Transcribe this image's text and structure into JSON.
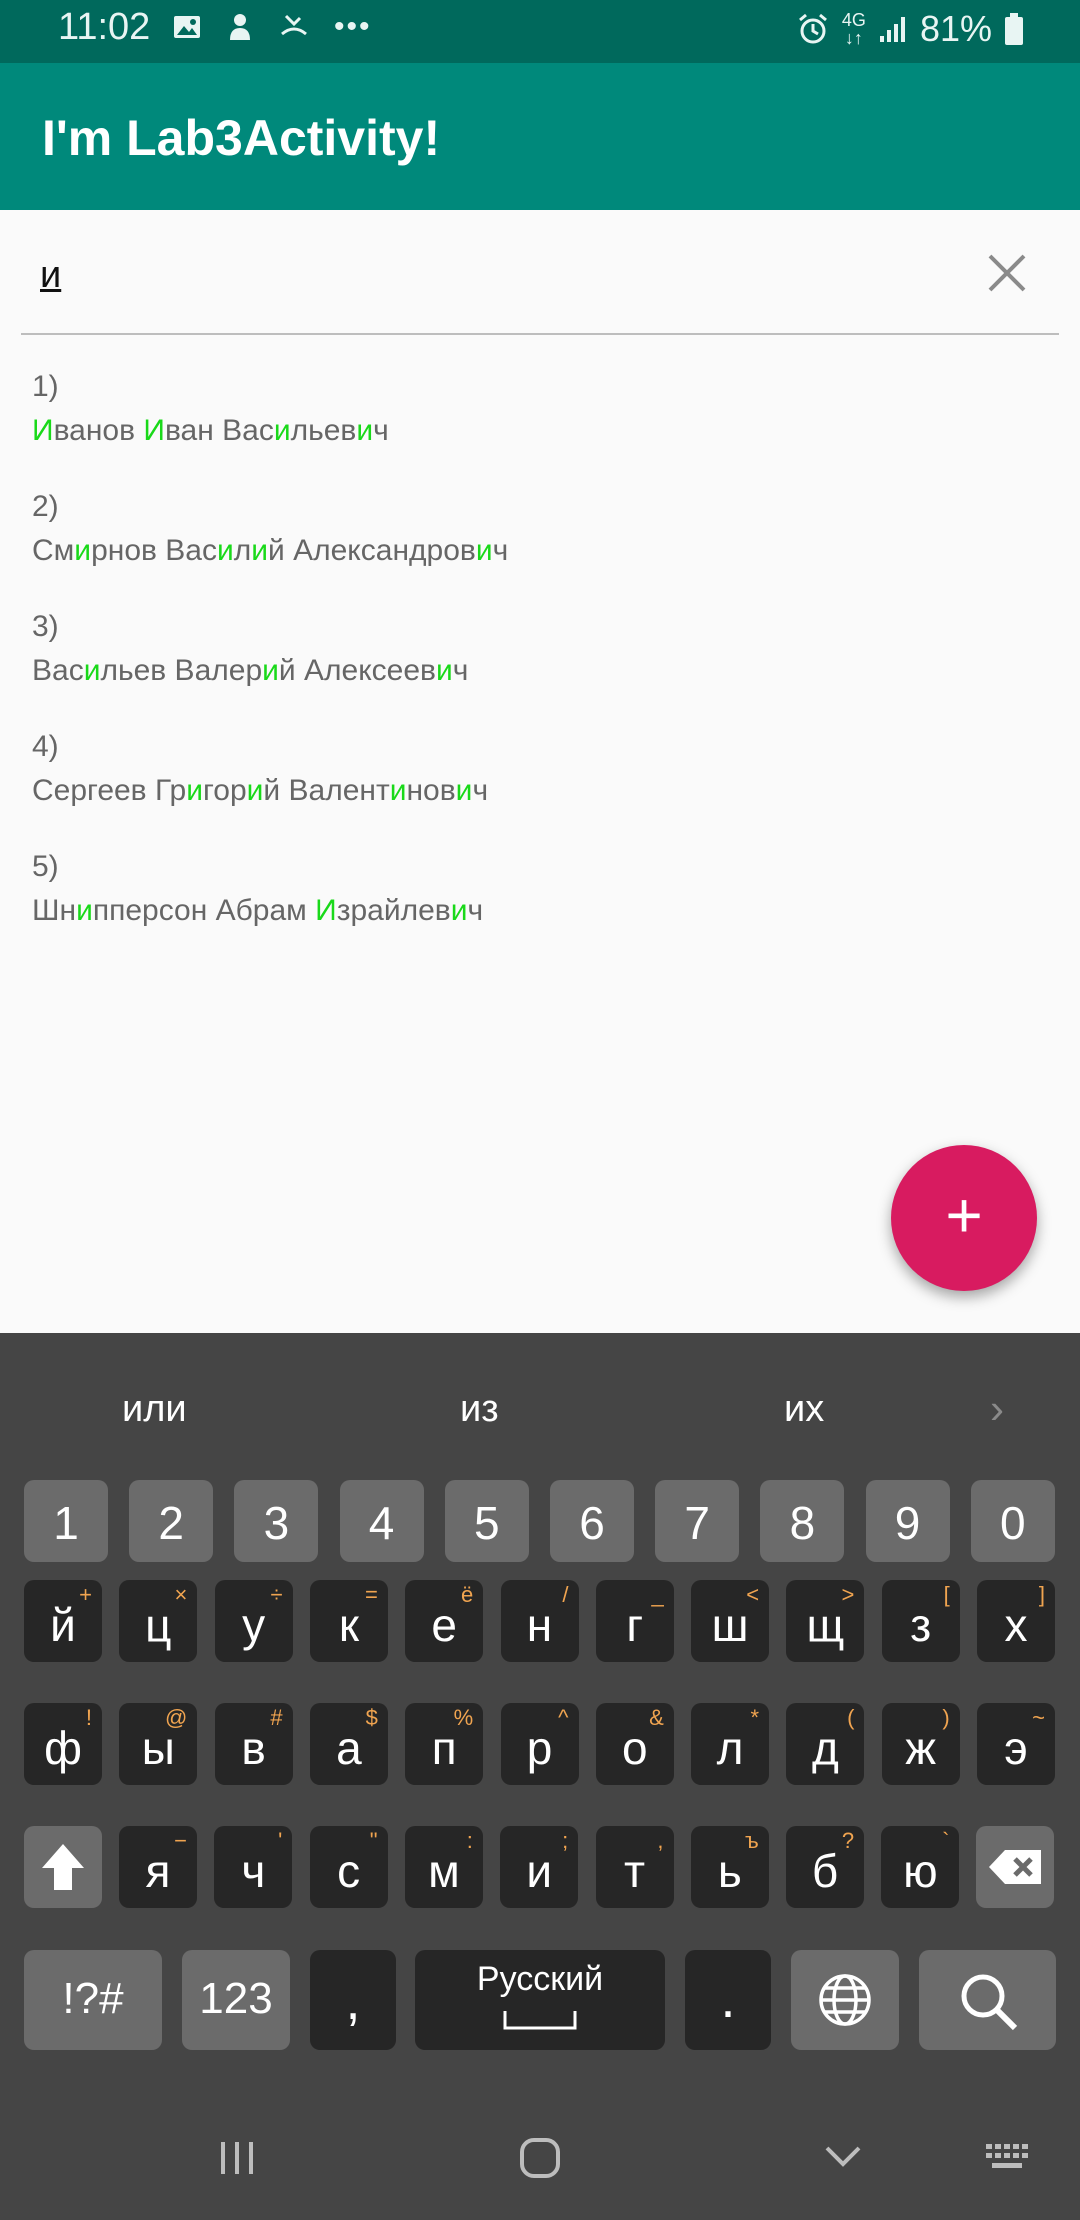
{
  "status_bar": {
    "time": "11:02",
    "left_icons": [
      "image-icon",
      "notification-icon",
      "missed-call-icon",
      "more-icon"
    ],
    "network": "4G",
    "battery": "81%"
  },
  "app_bar": {
    "title": "I'm Lab3Activity!"
  },
  "search": {
    "value": "и"
  },
  "results": [
    {
      "num": "1)",
      "segments": [
        [
          "И",
          1
        ],
        [
          "ванов ",
          0
        ],
        [
          "И",
          1
        ],
        [
          "ван Вас",
          0
        ],
        [
          "и",
          1
        ],
        [
          "льев",
          0
        ],
        [
          "и",
          1
        ],
        [
          "ч",
          0
        ]
      ]
    },
    {
      "num": "2)",
      "segments": [
        [
          "См",
          0
        ],
        [
          "и",
          1
        ],
        [
          "рнов Вас",
          0
        ],
        [
          "и",
          1
        ],
        [
          "л",
          0
        ],
        [
          "и",
          1
        ],
        [
          "й Александров",
          0
        ],
        [
          "и",
          1
        ],
        [
          "ч",
          0
        ]
      ]
    },
    {
      "num": "3)",
      "segments": [
        [
          "Вас",
          0
        ],
        [
          "и",
          1
        ],
        [
          "льев Валер",
          0
        ],
        [
          "и",
          1
        ],
        [
          "й Алексеев",
          0
        ],
        [
          "и",
          1
        ],
        [
          "ч",
          0
        ]
      ]
    },
    {
      "num": "4)",
      "segments": [
        [
          "Сергеев Гр",
          0
        ],
        [
          "и",
          1
        ],
        [
          "гор",
          0
        ],
        [
          "и",
          1
        ],
        [
          "й Валент",
          0
        ],
        [
          "и",
          1
        ],
        [
          "нов",
          0
        ],
        [
          "и",
          1
        ],
        [
          "ч",
          0
        ]
      ]
    },
    {
      "num": "5)",
      "segments": [
        [
          "Шн",
          0
        ],
        [
          "и",
          1
        ],
        [
          "пперсон Абрам ",
          0
        ],
        [
          "И",
          1
        ],
        [
          "зрайлев",
          0
        ],
        [
          "и",
          1
        ],
        [
          "ч",
          0
        ]
      ]
    }
  ],
  "fab": {
    "label": "+"
  },
  "keyboard": {
    "suggestions": [
      "или",
      "из",
      "их"
    ],
    "numbers": [
      "1",
      "2",
      "3",
      "4",
      "5",
      "6",
      "7",
      "8",
      "9",
      "0"
    ],
    "row1": [
      [
        "й",
        "+"
      ],
      [
        "ц",
        "×"
      ],
      [
        "у",
        "÷"
      ],
      [
        "к",
        "="
      ],
      [
        "е",
        "ё"
      ],
      [
        "н",
        "/"
      ],
      [
        "г",
        "_"
      ],
      [
        "ш",
        "<"
      ],
      [
        "щ",
        ">"
      ],
      [
        "з",
        "["
      ],
      [
        "х",
        "]"
      ]
    ],
    "row2": [
      [
        "ф",
        "!"
      ],
      [
        "ы",
        "@"
      ],
      [
        "в",
        "#"
      ],
      [
        "а",
        "$"
      ],
      [
        "п",
        "%"
      ],
      [
        "р",
        "^"
      ],
      [
        "о",
        "&"
      ],
      [
        "л",
        "*"
      ],
      [
        "д",
        "("
      ],
      [
        "ж",
        ")"
      ],
      [
        "э",
        "~"
      ]
    ],
    "row3": [
      [
        "я",
        "−"
      ],
      [
        "ч",
        "'"
      ],
      [
        "с",
        "\""
      ],
      [
        "м",
        ":"
      ],
      [
        "и",
        ";"
      ],
      [
        "т",
        ","
      ],
      [
        "ь",
        "ъ"
      ],
      [
        "б",
        "?"
      ],
      [
        "ю",
        "`"
      ]
    ],
    "symbols_label": "!?#",
    "numpad_label": "123",
    "comma": ",",
    "space_label": "Русский",
    "period": "."
  },
  "colors": {
    "app_bar": "#00897b",
    "status_bar": "#00695c",
    "fab": "#d81b60",
    "highlight": "#19d919"
  }
}
